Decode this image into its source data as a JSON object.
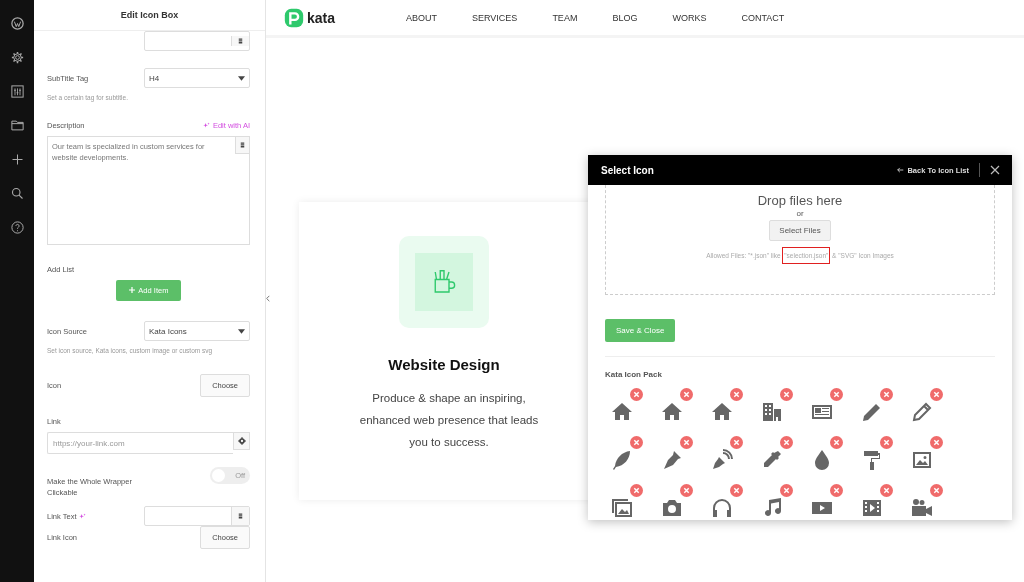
{
  "editor": {
    "title": "Edit Icon Box",
    "fields": [
      {
        "kind": "select",
        "label": "SubTitle Tag",
        "value": "H4",
        "help": "Set a certain tag for subtitle."
      },
      {
        "kind": "textarea",
        "label": "Description",
        "action": "Edit with AI",
        "value": "Our team is specialized in custom services for website developments."
      },
      {
        "kind": "add",
        "label": "Add List",
        "button": "Add Item"
      },
      {
        "kind": "select",
        "label": "Icon Source",
        "value": "Kata Icons",
        "help": "Set icon source, Kata icons, custom image or custom svg"
      },
      {
        "kind": "choose",
        "label": "Icon",
        "button": "Choose"
      },
      {
        "kind": "url",
        "label": "Link",
        "placeholder": "https://your-link.com"
      },
      {
        "kind": "toggle",
        "label": "Make the Whole Wrapper Clickable",
        "on": false,
        "state_text": "Off"
      },
      {
        "kind": "dynamic",
        "label": "Link Text"
      },
      {
        "kind": "choose",
        "label": "Link Icon",
        "button": "Choose"
      }
    ]
  },
  "site": {
    "logo": "kata",
    "nav": [
      "ABOUT",
      "SERVICES",
      "TEAM",
      "BLOG",
      "WORKS",
      "CONTACT"
    ]
  },
  "card": {
    "title": "Website Design",
    "text": "Produce & shape an inspiring, enhanced web presence that leads you to success."
  },
  "modal": {
    "title": "Select Icon",
    "back": "Back To Icon List",
    "drop_title": "Drop files here",
    "or": "or",
    "select_button": "Select Files",
    "allowed": {
      "before": "Allowed Files: \"*.json\" like ",
      "highlight": "\"selection.json\"",
      "after": " & \"SVG\" Icon Images"
    },
    "save_button": "Save & Close",
    "pack_title": "Kata Icon Pack",
    "icons": [
      {
        "kind": "house"
      },
      {
        "kind": "house"
      },
      {
        "kind": "house"
      },
      {
        "kind": "building"
      },
      {
        "kind": "newspaper"
      },
      {
        "kind": "pencil"
      },
      {
        "kind": "pencil-outline"
      },
      {
        "kind": "feather"
      },
      {
        "kind": "fountain-pen"
      },
      {
        "kind": "pen-signal"
      },
      {
        "kind": "eyedropper"
      },
      {
        "kind": "drop"
      },
      {
        "kind": "paint-roller"
      },
      {
        "kind": "image"
      },
      {
        "kind": "images"
      },
      {
        "kind": "camera"
      },
      {
        "kind": "headphones"
      },
      {
        "kind": "music"
      },
      {
        "kind": "play"
      },
      {
        "kind": "film"
      },
      {
        "kind": "video-camera"
      }
    ]
  }
}
